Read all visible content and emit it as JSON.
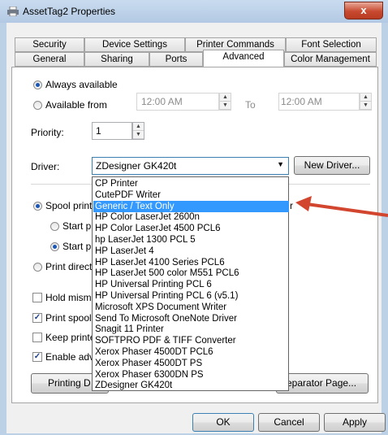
{
  "window": {
    "title": "AssetTag2 Properties",
    "close_label": "x"
  },
  "tabs_row1": [
    "Security",
    "Device Settings",
    "Printer Commands",
    "Font Selection"
  ],
  "tabs_row2": [
    "General",
    "Sharing",
    "Ports",
    "Advanced",
    "Color Management"
  ],
  "active_tab": "Advanced",
  "availability": {
    "always_label": "Always available",
    "available_from_label": "Available from",
    "from_time": "12:00 AM",
    "to_label": "To",
    "to_time": "12:00 AM",
    "selected": "always"
  },
  "priority": {
    "label": "Priority:",
    "value": "1"
  },
  "driver": {
    "label": "Driver:",
    "value": "ZDesigner GK420t",
    "new_driver_button": "New Driver..."
  },
  "driver_options": [
    "CP Printer",
    "CutePDF Writer",
    "Generic / Text Only",
    "HP Color LaserJet 2600n",
    "HP Color LaserJet 4500 PCL6",
    "hp LaserJet 1300 PCL 5",
    "HP LaserJet 4",
    "HP LaserJet 4100 Series PCL6",
    "HP LaserJet 500 color M551 PCL6",
    "HP Universal Printing PCL 6",
    "HP Universal Printing PCL 6 (v5.1)",
    "Microsoft XPS Document Writer",
    "Send To Microsoft OneNote Driver",
    "Snagit 11 Printer",
    "SOFTPRO PDF & TIFF Converter",
    "Xerox Phaser 4500DT PCL6",
    "Xerox Phaser 4500DT PS",
    "Xerox Phaser 6300DN PS",
    "ZDesigner GK420t"
  ],
  "highlighted_option_index": 2,
  "spool": {
    "spool_label": "Spool print",
    "spool_suffix": "r",
    "start_1_label": "Start pr",
    "start_2_label": "Start pr",
    "print_direct_label": "Print direct"
  },
  "checkboxes": [
    {
      "label": "Hold mism",
      "checked": false
    },
    {
      "label": "Print spool",
      "checked": true
    },
    {
      "label": "Keep printe",
      "checked": false
    },
    {
      "label": "Enable adv",
      "checked": true
    }
  ],
  "buttons": {
    "printing_defaults": "Printing D",
    "separator_page": "eparator Page...",
    "ok": "OK",
    "cancel": "Cancel",
    "apply": "Apply"
  },
  "colors": {
    "selection": "#3399ff",
    "arrow": "#d2452e"
  }
}
